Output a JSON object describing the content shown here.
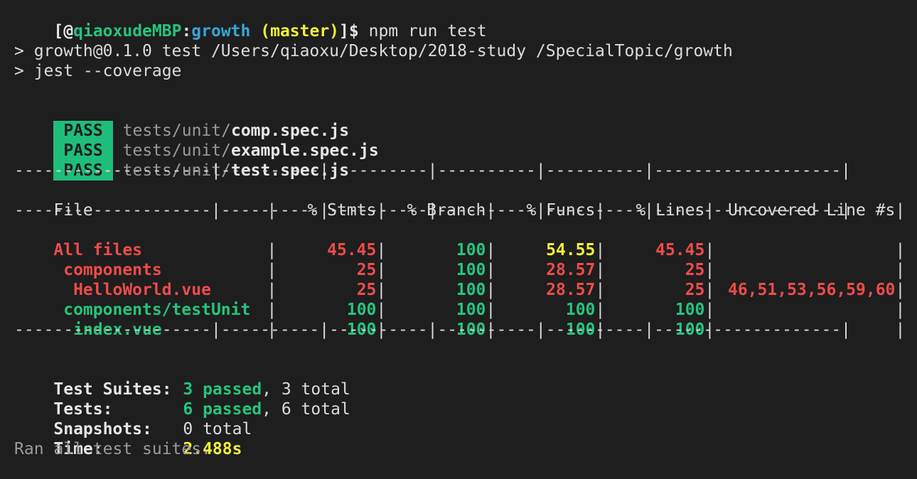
{
  "prompt": {
    "open": "[",
    "at": "@",
    "host": "qiaoxudeMBP",
    "colon": ":",
    "dir": "growth",
    "branch": "(master)",
    "close": "]$",
    "command": "npm run test"
  },
  "script_lines": [
    "> growth@0.1.0 test /Users/qiaoxu/Desktop/2018-study /SpecialTopic/growth",
    "> jest --coverage"
  ],
  "test_files": [
    {
      "status": "PASS",
      "dir": "tests/unit/",
      "file": "comp.spec.js"
    },
    {
      "status": "PASS",
      "dir": "tests/unit/",
      "file": "example.spec.js"
    },
    {
      "status": "PASS",
      "dir": "tests/unit/",
      "file": "test.spec.js"
    }
  ],
  "coverage": {
    "rule_line": "--------------------|----------|----------|----------|----------|-------------------|",
    "headers": [
      "File",
      "% Stmts",
      "% Branch",
      "% Funcs",
      "% Lines",
      "Uncovered Line #s"
    ],
    "rows": [
      {
        "file": "All files",
        "stmts": "45.45",
        "branch": "100",
        "funcs": "54.55",
        "lines": "45.45",
        "uncovered": ""
      },
      {
        "file": " components",
        "stmts": "25",
        "branch": "100",
        "funcs": "28.57",
        "lines": "25",
        "uncovered": ""
      },
      {
        "file": "  HelloWorld.vue",
        "stmts": "25",
        "branch": "100",
        "funcs": "28.57",
        "lines": "25",
        "uncovered": "46,51,53,56,59,60"
      },
      {
        "file": " components/testUnit",
        "stmts": "100",
        "branch": "100",
        "funcs": "100",
        "lines": "100",
        "uncovered": ""
      },
      {
        "file": "  index.vue",
        "stmts": "100",
        "branch": "100",
        "funcs": "100",
        "lines": "100",
        "uncovered": ""
      }
    ]
  },
  "summary": {
    "suites_label": "Test Suites:",
    "suites_passed": "3 passed",
    "suites_total": ", 3 total",
    "tests_label": "Tests:",
    "tests_passed": "6 passed",
    "tests_total": ", 6 total",
    "snapshots_label": "Snapshots:",
    "snapshots_value": "0 total",
    "time_label": "Time:",
    "time_value": "2.488s",
    "ran_all": "Ran all test suites."
  },
  "colors": {
    "background": "#1e1e1e",
    "pass_badge": "#1fbd7b",
    "green": "#25c47e",
    "red": "#ef4b4b",
    "yellow": "#f2f03a",
    "cyan": "#37a6d6"
  }
}
